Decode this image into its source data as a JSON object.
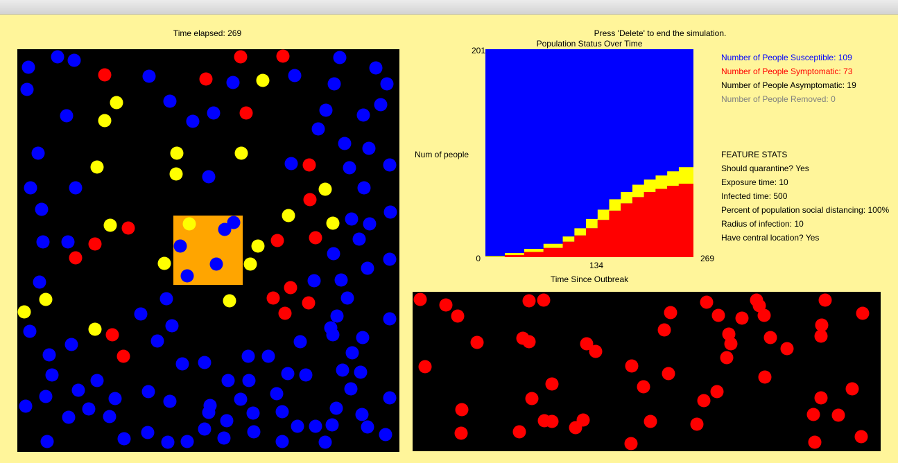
{
  "header": {
    "time_elapsed": "Time elapsed: 269",
    "instruction": "Press 'Delete' to end the simulation."
  },
  "colors": {
    "background": "#fff59a",
    "susceptible": "#0000ff",
    "symptomatic": "#ff0000",
    "asymptomatic": "#ffff00",
    "removed": "#808080",
    "central_location": "#ffa500",
    "panel": "#000000"
  },
  "legend": {
    "susceptible": "Number of People Susceptible: 109",
    "symptomatic": "Number of People Symptomatic: 73",
    "asymptomatic": "Number of People Asymptomatic: 19",
    "removed": "Number of People Removed: 0"
  },
  "feature_stats": {
    "heading": "FEATURE STATS",
    "quarantine": "Should quarantine? Yes",
    "exposure": "Exposure time: 10",
    "infected": "Infected time: 500",
    "social_distancing": "Percent of population social distancing: 100%",
    "radius": "Radius of infection: 10",
    "central": "Have central location? Yes"
  },
  "chart_data": {
    "type": "area",
    "title": "Population Status Over Time",
    "xlabel": "Time Since Outbreak",
    "ylabel": "Num of people",
    "xlim": [
      0,
      269
    ],
    "ylim": [
      0,
      201
    ],
    "x_ticks": [
      "0",
      "134",
      "269"
    ],
    "y_ticks": [
      "0",
      "201"
    ],
    "stacked": true,
    "x": [
      0,
      25,
      50,
      75,
      100,
      115,
      130,
      145,
      160,
      175,
      190,
      205,
      220,
      235,
      250,
      269
    ],
    "series": [
      {
        "name": "Symptomatic",
        "color": "#ff0000",
        "values": [
          0,
          2,
          5,
          9,
          15,
          21,
          28,
          36,
          45,
          52,
          58,
          63,
          66,
          69,
          71,
          73
        ]
      },
      {
        "name": "Asymptomatic",
        "color": "#ffff00",
        "values": [
          1,
          2,
          3,
          4,
          5,
          7,
          9,
          10,
          11,
          11,
          12,
          12,
          13,
          14,
          16,
          19
        ]
      },
      {
        "name": "Susceptible",
        "color": "#0000ff",
        "values": [
          200,
          197,
          193,
          188,
          181,
          173,
          164,
          155,
          145,
          138,
          131,
          126,
          122,
          118,
          114,
          109
        ]
      }
    ]
  }
}
